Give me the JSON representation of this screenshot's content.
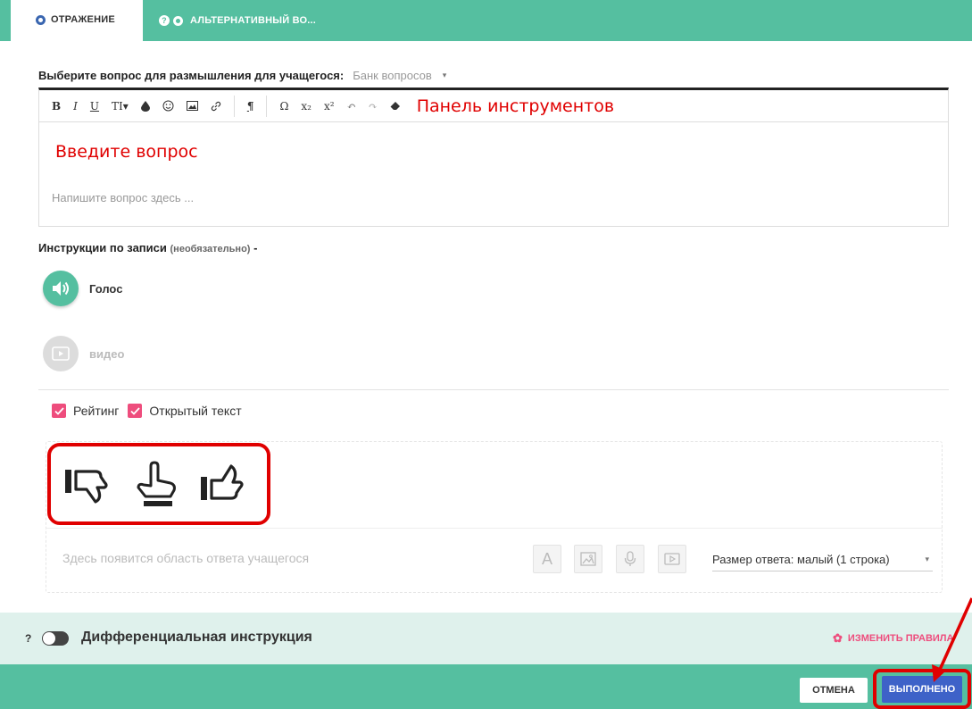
{
  "tabs": {
    "active_label": "ОТРАЖЕНИЕ",
    "inactive_label": "АЛЬТЕРНАТИВНЫЙ ВО...",
    "help_glyph": "?"
  },
  "question": {
    "label": "Выберите вопрос для размышления для учащегося:",
    "bank_label": "Банк вопросов",
    "caret": "▾"
  },
  "editor": {
    "toolbar": [
      "B",
      "I",
      "U",
      "TI▾",
      "💧",
      "☺",
      "🖼",
      "🔗",
      "¶",
      "Ω",
      "x₂",
      "x²",
      "↶",
      "↷",
      "⌫"
    ],
    "toolbar_annotation": "Панель инструментов",
    "body_annotation": "Введите вопрос",
    "placeholder": "Напишите вопрос здесь ..."
  },
  "instructions": {
    "label": "Инструкции по записи",
    "optional": "(необязательно)",
    "dash": "-",
    "voice_label": "Голос",
    "video_label": "видео"
  },
  "checkboxes": {
    "rating_label": "Рейтинг",
    "open_text_label": "Открытый текст"
  },
  "response": {
    "placeholder": "Здесь появится область ответа учащегося",
    "text_tool_glyph": "A",
    "size_label": "Размер ответа: малый (1 строка)",
    "size_caret": "▾"
  },
  "differential": {
    "help": "?",
    "label": "Дифференциальная инструкция",
    "change_rules": "ИЗМЕНИТЬ ПРАВИЛА"
  },
  "footer": {
    "cancel_label": "ОТМЕНА",
    "done_label": "ВЫПОЛНЕНО"
  },
  "colors": {
    "brand_green": "#55bfa0",
    "light_green": "#dff1ec",
    "pink_accent": "#ee4d7d",
    "annotation_red": "#e00000",
    "done_blue": "#3e62c8"
  }
}
